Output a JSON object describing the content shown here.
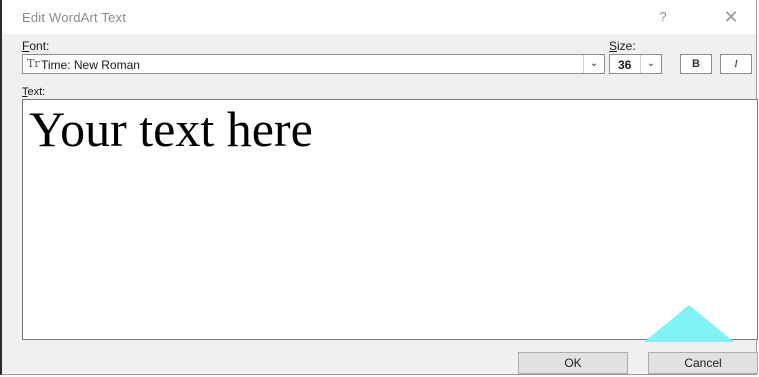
{
  "window": {
    "title": "Edit WordArt Text",
    "help_label": "?",
    "close_glyph": "✕"
  },
  "font": {
    "label_mnemonic": "F",
    "label_rest": "ont:",
    "icon_glyph": "Tr",
    "value": "Time: New Roman",
    "dropdown_glyph": "⌄"
  },
  "size": {
    "label_mnemonic": "S",
    "label_rest": "ize:",
    "value": "36",
    "dropdown_glyph": "⌄"
  },
  "format_buttons": {
    "bold_label": "B",
    "italic_label": "I"
  },
  "text": {
    "label_mnemonic": "T",
    "label_rest": "ext:",
    "value": "Your text here"
  },
  "buttons": {
    "ok_label": "OK",
    "cancel_label": "Cancel"
  },
  "colors": {
    "watermark": "#80f2f4"
  }
}
